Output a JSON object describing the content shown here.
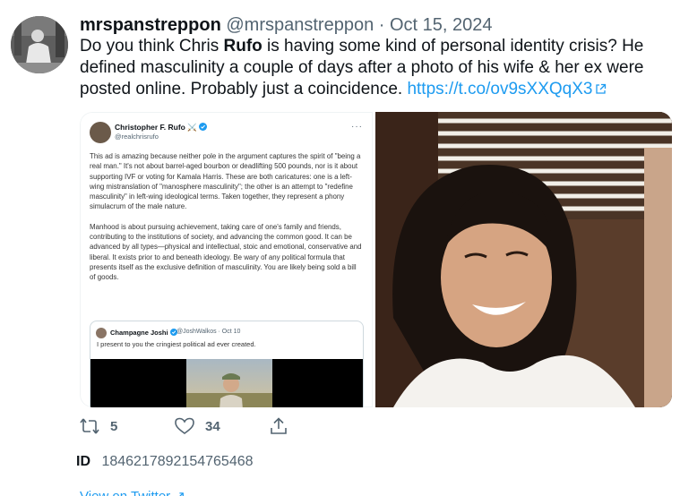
{
  "author": {
    "name": "mrspanstreppon",
    "handle": "@mrspanstreppon",
    "separator": "·",
    "date": "Oct 15, 2024"
  },
  "tweet": {
    "text_before": "Do you think Chris ",
    "highlight": "Rufo",
    "text_after": " is having some kind of personal identity crisis? He defined masculinity a couple of days after a photo of his wife & her ex were posted online. Probably just a coincidence. ",
    "link": "https://t.co/ov9sXXQqX3"
  },
  "embedded": {
    "name": "Christopher F. Rufo",
    "name_emoji": "⚔️",
    "handle": "@realchrisrufo",
    "more": "···",
    "paragraph_1": "This ad is amazing because neither pole in the argument captures the spirit of \"being a real man.\" It's not about barrel-aged bourbon or deadlifting 500 pounds, nor is it about supporting IVF or voting for Kamala Harris. These are both caricatures: one is a left-wing mistranslation of \"manosphere masculinity\"; the other is an attempt to \"redefine masculinity\" in left-wing ideological terms. Taken together, they represent a phony simulacrum of the male nature.",
    "paragraph_2": "Manhood is about pursuing achievement, taking care of one's family and friends, contributing to the institutions of society, and advancing the common good. It can be advanced by all types—physical and intellectual, stoic and emotional, conservative and liberal. It exists prior to and beneath ideology. Be wary of any political formula that presents itself as the exclusive definition of masculinity. You are likely being sold a bill of goods.",
    "quote": {
      "name": "Champagne Joshi",
      "handle": "@JoshWalkos · Oct 10",
      "text": "I present to you the cringiest political ad ever created."
    }
  },
  "stats": {
    "retweets": "5",
    "likes": "34"
  },
  "id_row": {
    "label": "ID",
    "value": "1846217892154765468"
  },
  "footer": {
    "view_link": "View on Twitter ↗"
  },
  "icons": {
    "retweet": "retweet-icon",
    "like": "heart-icon",
    "share": "share-icon",
    "external": "external-link-icon",
    "verified": "verified-badge-icon"
  },
  "colors": {
    "link": "#1d9bf0",
    "muted": "#536471",
    "text": "#0f1419"
  }
}
